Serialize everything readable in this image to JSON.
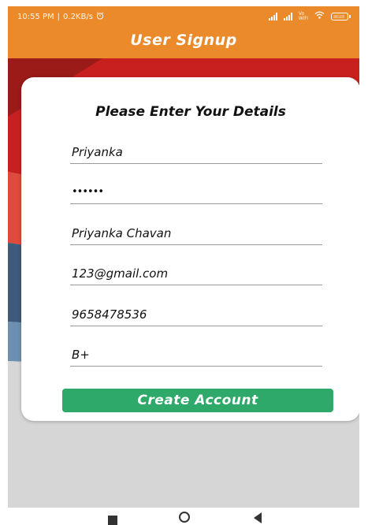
{
  "status_bar": {
    "time": "10:55 PM",
    "speed": "0.2KB/s",
    "alarm_icon": "alarm-clock-icon",
    "volte_label": "Vo\nWiFi",
    "wifi_icon": "wifi-icon",
    "battery_level": 0.9,
    "battery_label": "90"
  },
  "app_bar": {
    "title": "User Signup",
    "color": "#ea8a2a"
  },
  "form": {
    "heading": "Please Enter Your Details",
    "fields": [
      {
        "value": "Priyanka"
      },
      {
        "value": "••••••"
      },
      {
        "value": "Priyanka Chavan"
      },
      {
        "value": "123@gmail.com"
      },
      {
        "value": "9658478536"
      },
      {
        "value": "B+"
      }
    ],
    "submit_label": "Create Account",
    "submit_color": "#2fa96a"
  },
  "nav_bar": {
    "recents_icon": "square-recents-icon",
    "home_icon": "circle-home-icon",
    "back_icon": "triangle-back-icon"
  }
}
